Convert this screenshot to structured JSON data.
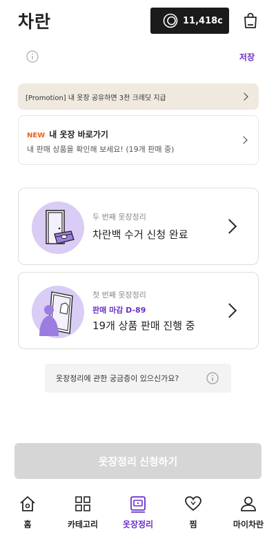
{
  "header": {
    "logo": "차란",
    "credit_amount": "11,418c",
    "icons": {
      "credit": "credit-coin-icon",
      "bag": "shopping-bag-icon"
    }
  },
  "info_row": {
    "save_label": "저장",
    "icon": "info-icon"
  },
  "promo": {
    "text": "[Promotion] 내 옷장 공유하면 3천 크레딧 지급"
  },
  "closet_link": {
    "tag": "NEW",
    "title": "내 옷장 바로가기",
    "subtitle": "내 판매 상품을 확인해 보세요! (19개 판매 중)"
  },
  "cards": [
    {
      "label": "두 번째 옷장정리",
      "status": "차란백 수거 신청 완료",
      "icon": "door-bag-illustration"
    },
    {
      "label": "첫 번째 옷장정리",
      "deadline": "판매 마감 D-89",
      "status": "19개 상품 판매 진행 중",
      "icon": "mirror-person-illustration"
    }
  ],
  "faq": {
    "text": "옷장정리에 관한 궁금증이 있으신가요?",
    "icon": "info-icon"
  },
  "apply_button": {
    "label": "옷장정리 신청하기"
  },
  "tabbar": {
    "tabs": [
      {
        "label": "홈",
        "icon": "home-icon"
      },
      {
        "label": "카테고리",
        "icon": "category-grid-icon"
      },
      {
        "label": "옷장정리",
        "icon": "closet-icon",
        "active": true
      },
      {
        "label": "찜",
        "icon": "heart-icon"
      },
      {
        "label": "마이차란",
        "icon": "user-icon"
      }
    ]
  },
  "colors": {
    "accent": "#6a2fc9",
    "new_tag": "#e8611d",
    "promo_bg": "#efe9df",
    "button_disabled": "#d6d6d6",
    "illustration": "#d9ccf5"
  }
}
